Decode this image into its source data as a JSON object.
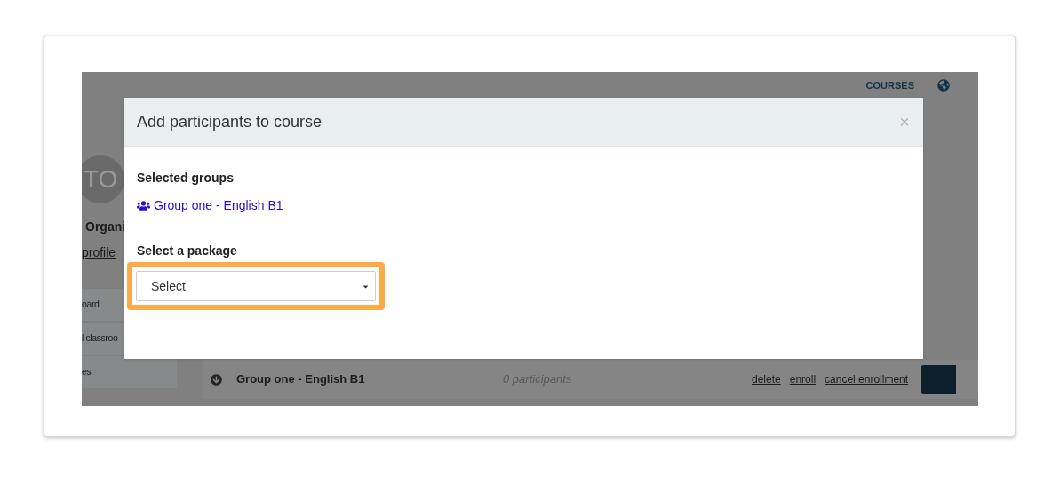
{
  "background": {
    "nav": [
      "COURSES"
    ],
    "avatar": "TO",
    "org": "Organi",
    "profile_link": "profile",
    "menu": [
      {
        "label": "oard"
      },
      {
        "label": "l classroo"
      },
      {
        "label": "es"
      }
    ],
    "row": {
      "name": "Group one - English B1",
      "count": "0 participants",
      "actions": [
        "delete",
        "enroll",
        "cancel enrollment"
      ]
    }
  },
  "modal": {
    "title": "Add participants to course",
    "close": "×",
    "groups_label": "Selected groups",
    "groups": [
      {
        "name": "Group one - English B1"
      }
    ],
    "package_label": "Select a package",
    "package_select": {
      "value": "Select",
      "highlighted": true
    }
  }
}
